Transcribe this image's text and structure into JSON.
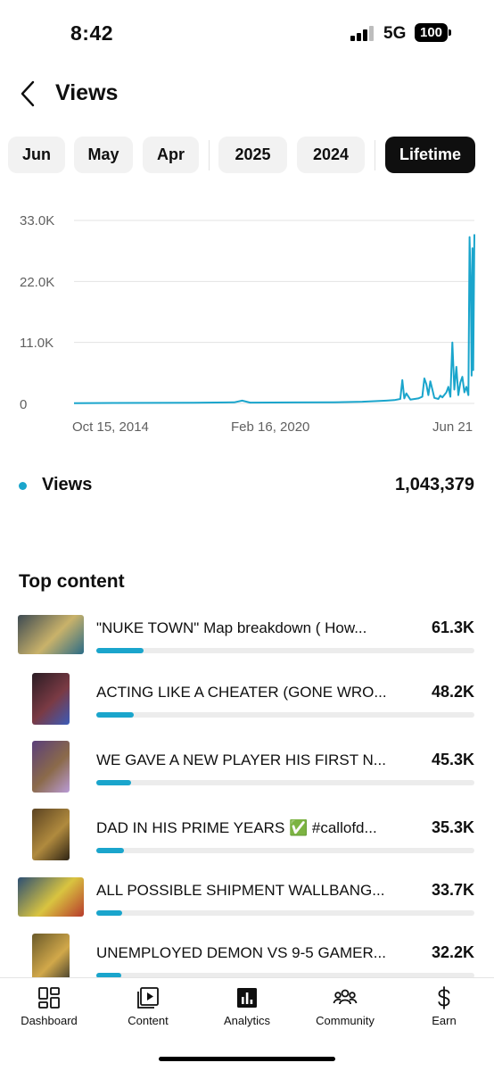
{
  "status_bar": {
    "time": "8:42",
    "network": "5G",
    "battery": "100"
  },
  "header": {
    "title": "Views"
  },
  "filters": [
    {
      "label": "Jun",
      "active": false
    },
    {
      "label": "May",
      "active": false
    },
    {
      "label": "Apr",
      "active": false
    },
    {
      "label": "2025",
      "active": false
    },
    {
      "label": "2024",
      "active": false
    },
    {
      "label": "Lifetime",
      "active": true
    }
  ],
  "chart_data": {
    "type": "line",
    "y_ticks": [
      "33.0K",
      "22.0K",
      "11.0K",
      "0"
    ],
    "x_ticks": [
      "Oct 15, 2014",
      "Feb 16, 2020",
      "Jun 21"
    ],
    "ylim": [
      0,
      33000
    ],
    "grid": true,
    "series": [
      {
        "name": "Views",
        "color": "#1aa5cc",
        "points": [
          [
            0.0,
            50
          ],
          [
            0.1,
            80
          ],
          [
            0.2,
            100
          ],
          [
            0.3,
            120
          ],
          [
            0.4,
            200
          ],
          [
            0.42,
            500
          ],
          [
            0.44,
            150
          ],
          [
            0.55,
            180
          ],
          [
            0.65,
            200
          ],
          [
            0.72,
            300
          ],
          [
            0.75,
            400
          ],
          [
            0.78,
            500
          ],
          [
            0.8,
            600
          ],
          [
            0.815,
            800
          ],
          [
            0.82,
            4200
          ],
          [
            0.825,
            900
          ],
          [
            0.83,
            1800
          ],
          [
            0.84,
            700
          ],
          [
            0.86,
            900
          ],
          [
            0.87,
            1200
          ],
          [
            0.875,
            4500
          ],
          [
            0.88,
            3500
          ],
          [
            0.885,
            1500
          ],
          [
            0.89,
            4000
          ],
          [
            0.895,
            2500
          ],
          [
            0.9,
            1000
          ],
          [
            0.91,
            800
          ],
          [
            0.915,
            1400
          ],
          [
            0.92,
            1100
          ],
          [
            0.93,
            2000
          ],
          [
            0.935,
            3000
          ],
          [
            0.94,
            1200
          ],
          [
            0.945,
            11000
          ],
          [
            0.95,
            2500
          ],
          [
            0.955,
            6600
          ],
          [
            0.96,
            1500
          ],
          [
            0.965,
            3800
          ],
          [
            0.97,
            4800
          ],
          [
            0.975,
            2000
          ],
          [
            0.98,
            3000
          ],
          [
            0.985,
            1500
          ],
          [
            0.988,
            30000
          ],
          [
            0.991,
            20000
          ],
          [
            0.993,
            5000
          ],
          [
            0.995,
            28000
          ],
          [
            0.997,
            6000
          ],
          [
            1.0,
            30500
          ]
        ]
      }
    ]
  },
  "legend": {
    "label": "Views",
    "total": "1,043,379"
  },
  "top_content": {
    "title": "Top content",
    "items": [
      {
        "title": "\"NUKE TOWN\" Map breakdown ( How...",
        "value": "61.3K",
        "fraction": 0.126,
        "thumb": "wide",
        "colors": [
          "#3d4a52",
          "#c9b26a",
          "#2a6b86"
        ]
      },
      {
        "title": "ACTING LIKE A CHEATER (GONE WRO...",
        "value": "48.2K",
        "fraction": 0.099,
        "thumb": "tall",
        "colors": [
          "#2b1d24",
          "#7a3a44",
          "#3b5bb8"
        ]
      },
      {
        "title": "WE GAVE A NEW PLAYER HIS FIRST N...",
        "value": "45.3K",
        "fraction": 0.093,
        "thumb": "tall",
        "colors": [
          "#5a3f7a",
          "#8b6a4a",
          "#b99bd6"
        ]
      },
      {
        "title": "DAD IN HIS PRIME YEARS ✅ #callofd...",
        "value": "35.3K",
        "fraction": 0.073,
        "thumb": "tall",
        "colors": [
          "#5b4322",
          "#b08a3e",
          "#2e2414"
        ]
      },
      {
        "title": "ALL POSSIBLE SHIPMENT WALLBANG...",
        "value": "33.7K",
        "fraction": 0.069,
        "thumb": "wide",
        "colors": [
          "#2c4f73",
          "#d9c440",
          "#b73b2c"
        ]
      },
      {
        "title": "UNEMPLOYED DEMON VS 9-5 GAMER...",
        "value": "32.2K",
        "fraction": 0.066,
        "thumb": "tall",
        "colors": [
          "#6a5a2a",
          "#d1a84a",
          "#30302a"
        ]
      }
    ]
  },
  "bottom_nav": [
    {
      "label": "Dashboard",
      "icon": "dashboard-icon"
    },
    {
      "label": "Content",
      "icon": "content-icon"
    },
    {
      "label": "Analytics",
      "icon": "analytics-icon"
    },
    {
      "label": "Community",
      "icon": "community-icon"
    },
    {
      "label": "Earn",
      "icon": "earn-icon"
    }
  ]
}
